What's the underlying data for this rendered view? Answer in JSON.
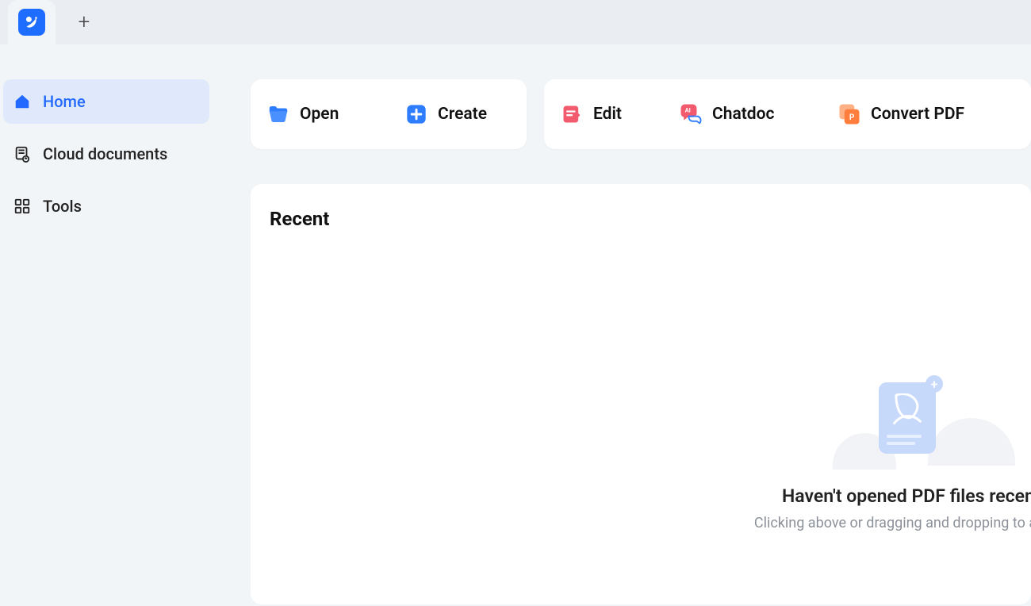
{
  "sidebar": {
    "items": [
      {
        "key": "home",
        "label": "Home"
      },
      {
        "key": "cloud",
        "label": "Cloud documents"
      },
      {
        "key": "tools",
        "label": "Tools"
      }
    ]
  },
  "actions": {
    "open": {
      "label": "Open"
    },
    "create": {
      "label": "Create"
    },
    "edit": {
      "label": "Edit"
    },
    "chatdoc": {
      "label": "Chatdoc"
    },
    "convert": {
      "label": "Convert PDF"
    }
  },
  "recent": {
    "title": "Recent",
    "empty_heading": "Haven't opened PDF files recently",
    "empty_sub": "Clicking above or dragging and dropping to add files"
  }
}
